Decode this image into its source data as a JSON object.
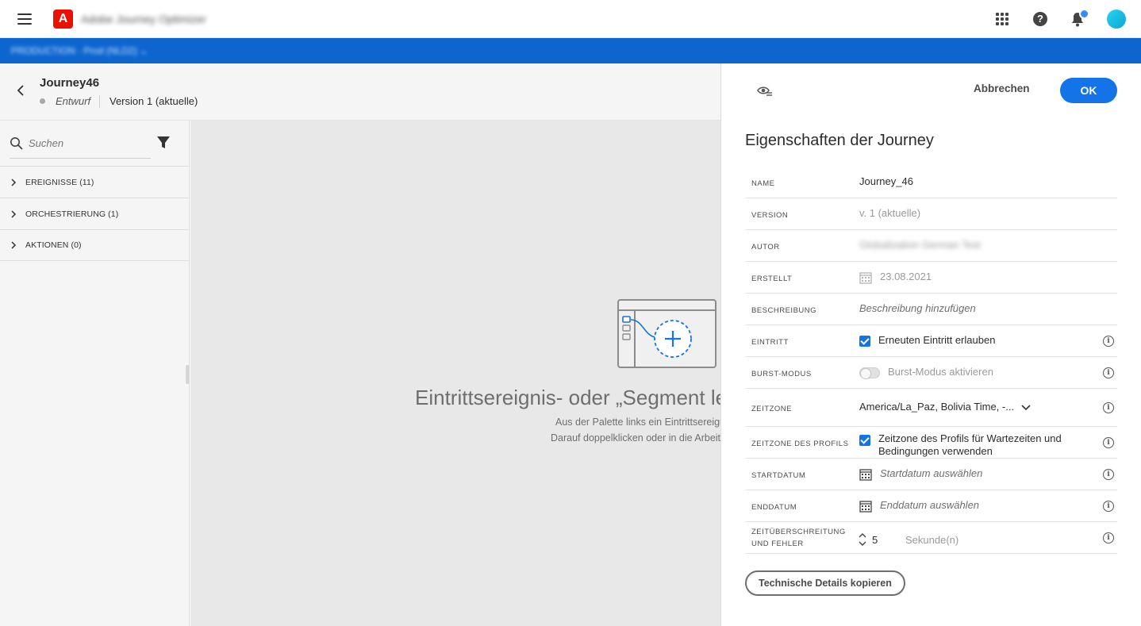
{
  "topbar": {
    "app_title": "Adobe Journey Optimizer",
    "logo_letter": "A"
  },
  "bluebar": {
    "sandbox": "PRODUCTION · Prod (NLD2)  ⌄"
  },
  "journey": {
    "name": "Journey46",
    "status": "Entwurf",
    "version": "Version 1 (aktuelle)"
  },
  "palette": {
    "search_placeholder": "Suchen",
    "sections": [
      {
        "label": "EREIGNISSE (11)"
      },
      {
        "label": "ORCHESTRIERUNG (1)"
      },
      {
        "label": "AKTIONEN (0)"
      }
    ]
  },
  "canvas": {
    "title": "Eintrittsereignis- oder „Segment lese",
    "desc_line1": "Aus der Palette links ein Eintrittsereign",
    "desc_line2": "Darauf doppelklicken oder in die Arbeit"
  },
  "panel": {
    "cancel_label": "Abbrechen",
    "ok_label": "OK",
    "title": "Eigenschaften der Journey",
    "rows": {
      "name": {
        "label": "NAME",
        "value": "Journey_46"
      },
      "version": {
        "label": "VERSION",
        "value": "v. 1 (aktuelle)"
      },
      "author": {
        "label": "AUTOR",
        "value": "Globalization German Test"
      },
      "created": {
        "label": "ERSTELLT",
        "value": "23.08.2021"
      },
      "description": {
        "label": "BESCHREIBUNG",
        "value": "Beschreibung hinzufügen"
      },
      "entry": {
        "label": "EINTRITT",
        "value": "Erneuten Eintritt erlauben",
        "checked": true
      },
      "burst": {
        "label": "BURST-MODUS",
        "value": "Burst-Modus aktivieren",
        "enabled": false
      },
      "timezone": {
        "label": "ZEITZONE",
        "value": "America/La_Paz, Bolivia Time, -..."
      },
      "profile_tz": {
        "label": "ZEITZONE DES PROFILS",
        "value_line1": "Zeitzone des Profils für Wartezeiten und",
        "value_line2": "Bedingungen verwenden",
        "checked": true
      },
      "start": {
        "label": "STARTDATUM",
        "value": "Startdatum auswählen"
      },
      "end": {
        "label": "ENDDATUM",
        "value": "Enddatum auswählen"
      },
      "timeout": {
        "label_line1": "ZEITÜBERSCHREITUNG",
        "label_line2": "UND FEHLER",
        "value": "5",
        "unit": "Sekunde(n)"
      }
    },
    "tech_button": "Technische Details kopieren"
  },
  "colors": {
    "brand_blue": "#0d66d0",
    "accent": "#1473e6",
    "adobe_red": "#eb1000"
  }
}
